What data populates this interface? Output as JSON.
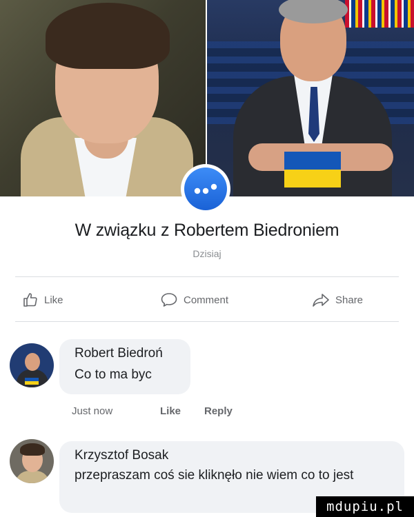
{
  "headline": {
    "prefix": "W związku z",
    "name": "Robertem Biedroniem"
  },
  "timestamp": "Dzisiaj",
  "actions": {
    "like": "Like",
    "comment": "Comment",
    "share": "Share"
  },
  "comments": [
    {
      "author": "Robert Biedroń",
      "text": "Co to ma byc",
      "time": "Just now",
      "like": "Like",
      "reply": "Reply"
    },
    {
      "author": "Krzysztof Bosak",
      "text": "przepraszam coś sie kliknęło nie wiem co to jest"
    }
  ],
  "watermark": "mdupiu.pl",
  "colors": {
    "facebook_blue": "#1877f2",
    "ukraine_blue": "#1457b8",
    "ukraine_yellow": "#f7d117",
    "text_primary": "#1c1e21",
    "text_secondary": "#65676b",
    "bubble": "#f0f2f5"
  },
  "icons": {
    "badge": "messenger-badge-icon",
    "like": "thumbs-up-icon",
    "comment": "speech-bubble-icon",
    "share": "share-arrow-icon"
  }
}
